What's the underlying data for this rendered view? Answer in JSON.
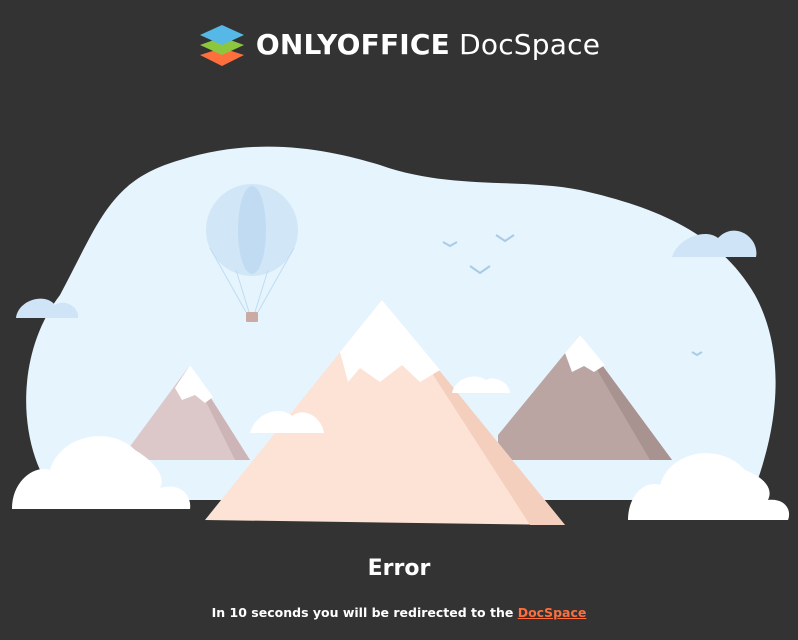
{
  "header": {
    "brand_bold": "ONLYOFFICE",
    "brand_light": "DocSpace",
    "logo_icon": "onlyoffice-layers-icon"
  },
  "main": {
    "illustration_icon": "mountains-balloon-illustration",
    "title": "Error",
    "redirect_prefix": "In 10 seconds you will be redirected to the ",
    "redirect_link": "DocSpace"
  },
  "colors": {
    "background": "#333333",
    "link": "#ff6f3d",
    "sky": "#e6f4fd",
    "logo_blue": "#55b8e6",
    "logo_green": "#8cc63f",
    "logo_orange": "#ff6f3d"
  }
}
